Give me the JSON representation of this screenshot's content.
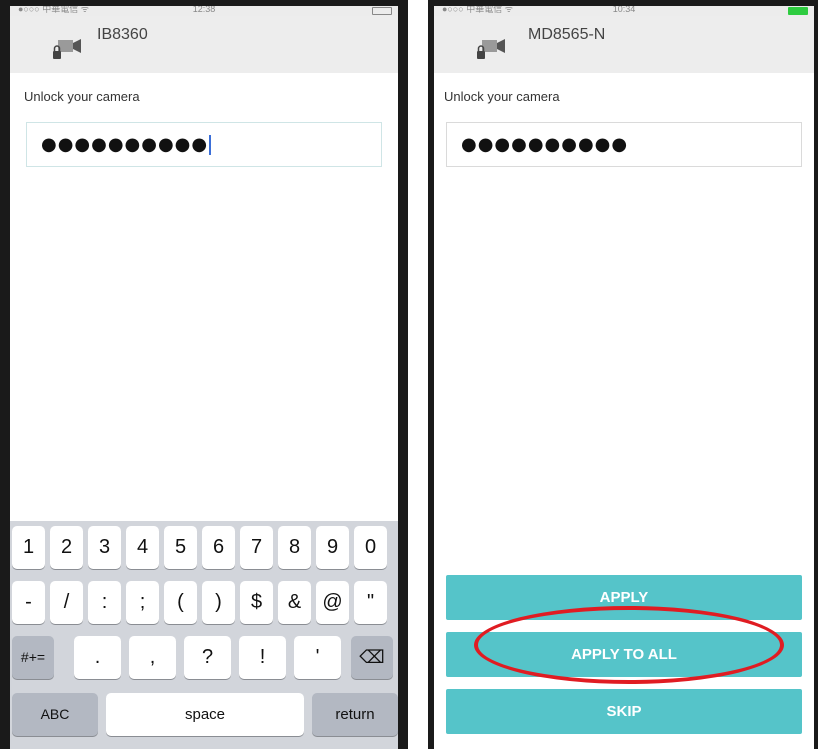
{
  "left": {
    "status": {
      "carrier": "●○○○ 中華電信 ᯤ",
      "time": "12:38"
    },
    "camera_name": "IB8360",
    "prompt": "Unlock your camera",
    "password_mask": "●●●●●●●●●●",
    "keyboard": {
      "row1": [
        "1",
        "2",
        "3",
        "4",
        "5",
        "6",
        "7",
        "8",
        "9",
        "0"
      ],
      "row2": [
        "-",
        "/",
        ":",
        ";",
        "(",
        ")",
        "$",
        "&",
        "@",
        "\""
      ],
      "row3": [
        "#+=",
        ".",
        ",",
        "?",
        "!",
        "'",
        "⌫"
      ],
      "row4": [
        "ABC",
        "space",
        "return"
      ]
    }
  },
  "right": {
    "status": {
      "carrier": "●○○○ 中華電信 ᯤ",
      "time": "10:34"
    },
    "camera_name": "MD8565-N",
    "prompt": "Unlock your camera",
    "password_mask": "●●●●●●●●●●",
    "buttons": {
      "apply": "APPLY",
      "apply_all": "APPLY TO ALL",
      "skip": "SKIP"
    }
  },
  "colors": {
    "accent": "#55c4c9",
    "highlight": "#e01c22",
    "keyboard_bg": "#d2d5db"
  },
  "icons": [
    "camera-lock-icon",
    "delete-key-icon"
  ]
}
